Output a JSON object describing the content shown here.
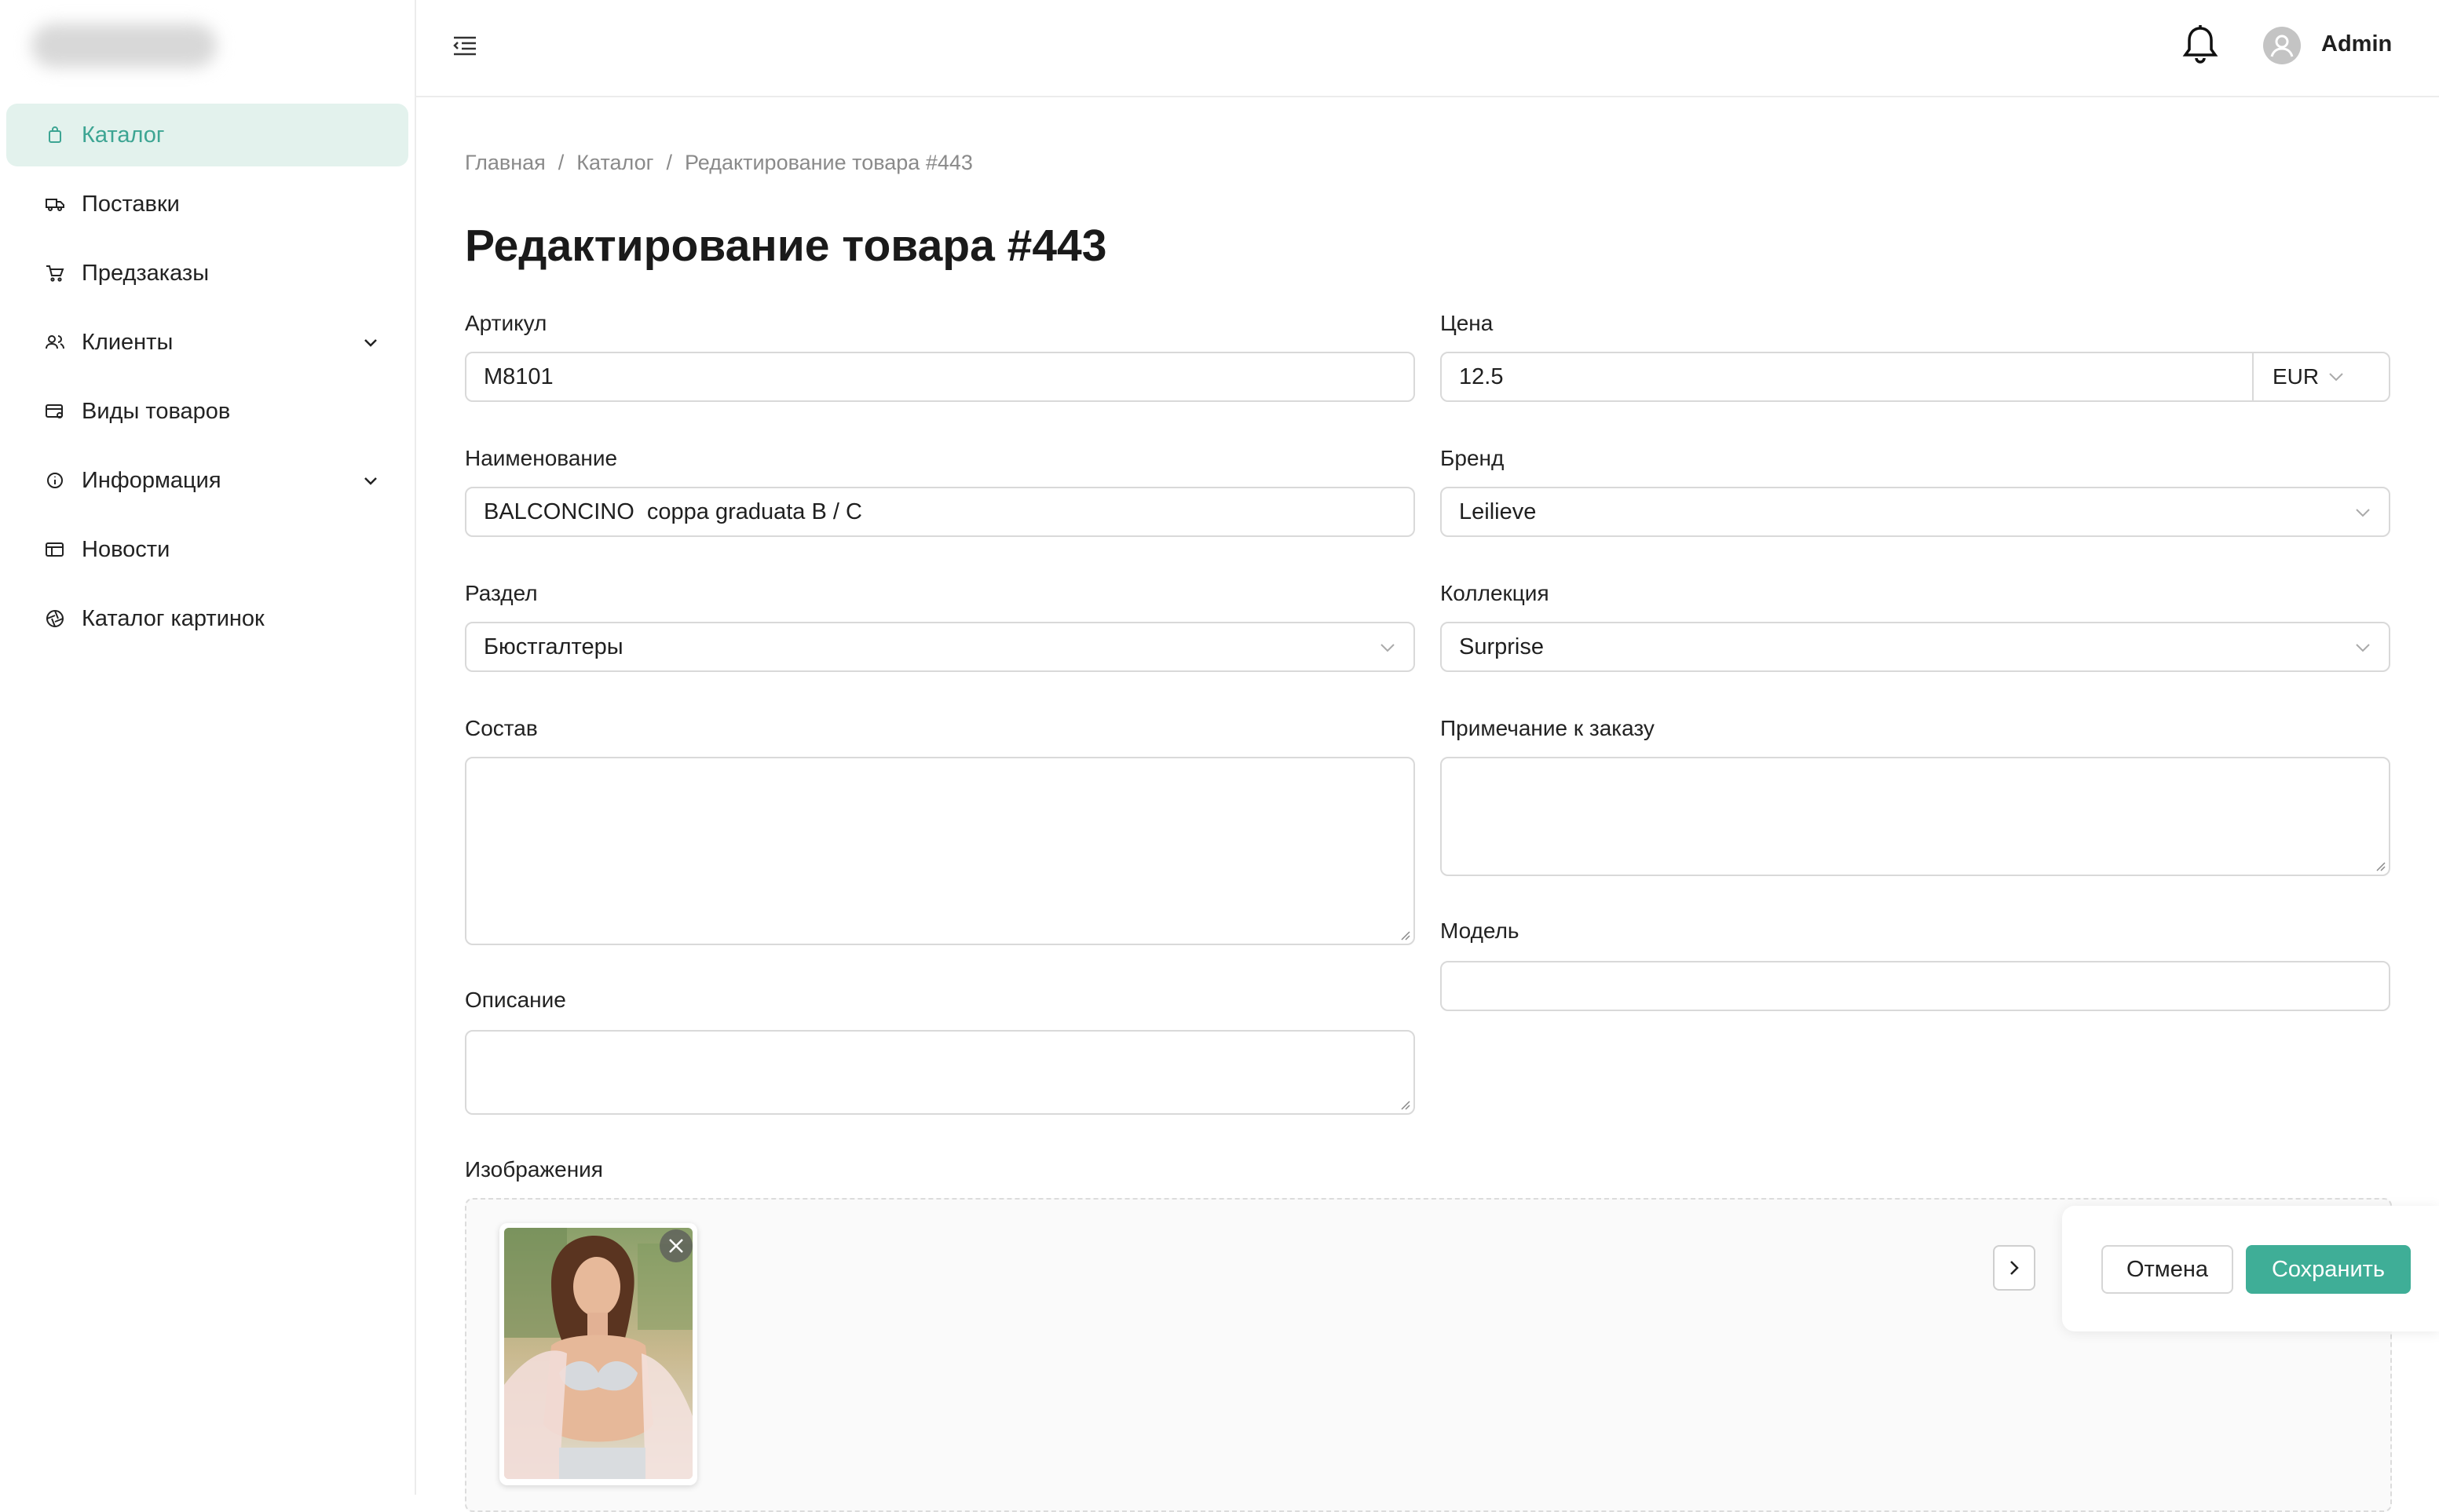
{
  "sidebar": {
    "items": [
      {
        "label": "Каталог",
        "icon": "shopping-bag-icon",
        "active": true
      },
      {
        "label": "Поставки",
        "icon": "truck-icon"
      },
      {
        "label": "Предзаказы",
        "icon": "cart-icon"
      },
      {
        "label": "Клиенты",
        "icon": "users-icon",
        "expandable": true
      },
      {
        "label": "Виды товаров",
        "icon": "card-icon"
      },
      {
        "label": "Информация",
        "icon": "info-icon",
        "expandable": true
      },
      {
        "label": "Новости",
        "icon": "news-icon"
      },
      {
        "label": "Каталог картинок",
        "icon": "aperture-icon"
      }
    ]
  },
  "header": {
    "user_name": "Admin"
  },
  "breadcrumb": {
    "home": "Главная",
    "catalog": "Каталог",
    "current": "Редактирование товара #443"
  },
  "page_title": "Редактирование товара #443",
  "form": {
    "sku": {
      "label": "Артикул",
      "value": "M8101"
    },
    "price": {
      "label": "Цена",
      "value": "12.5",
      "currency": "EUR"
    },
    "name": {
      "label": "Наименование",
      "value": "BALCONCINO  coppa graduata B / C"
    },
    "brand": {
      "label": "Бренд",
      "value": "Leilieve"
    },
    "section": {
      "label": "Раздел",
      "value": "Бюстгалтеры"
    },
    "collection": {
      "label": "Коллекция",
      "value": "Surprise"
    },
    "composition": {
      "label": "Состав",
      "value": ""
    },
    "order_note": {
      "label": "Примечание к заказу",
      "value": ""
    },
    "model": {
      "label": "Модель",
      "value": ""
    },
    "description": {
      "label": "Описание",
      "value": ""
    },
    "images": {
      "label": "Изображения"
    }
  },
  "actions": {
    "cancel": "Отмена",
    "save": "Сохранить"
  },
  "colors": {
    "accent": "#3fae97",
    "active_bg": "#e3f2ed"
  }
}
